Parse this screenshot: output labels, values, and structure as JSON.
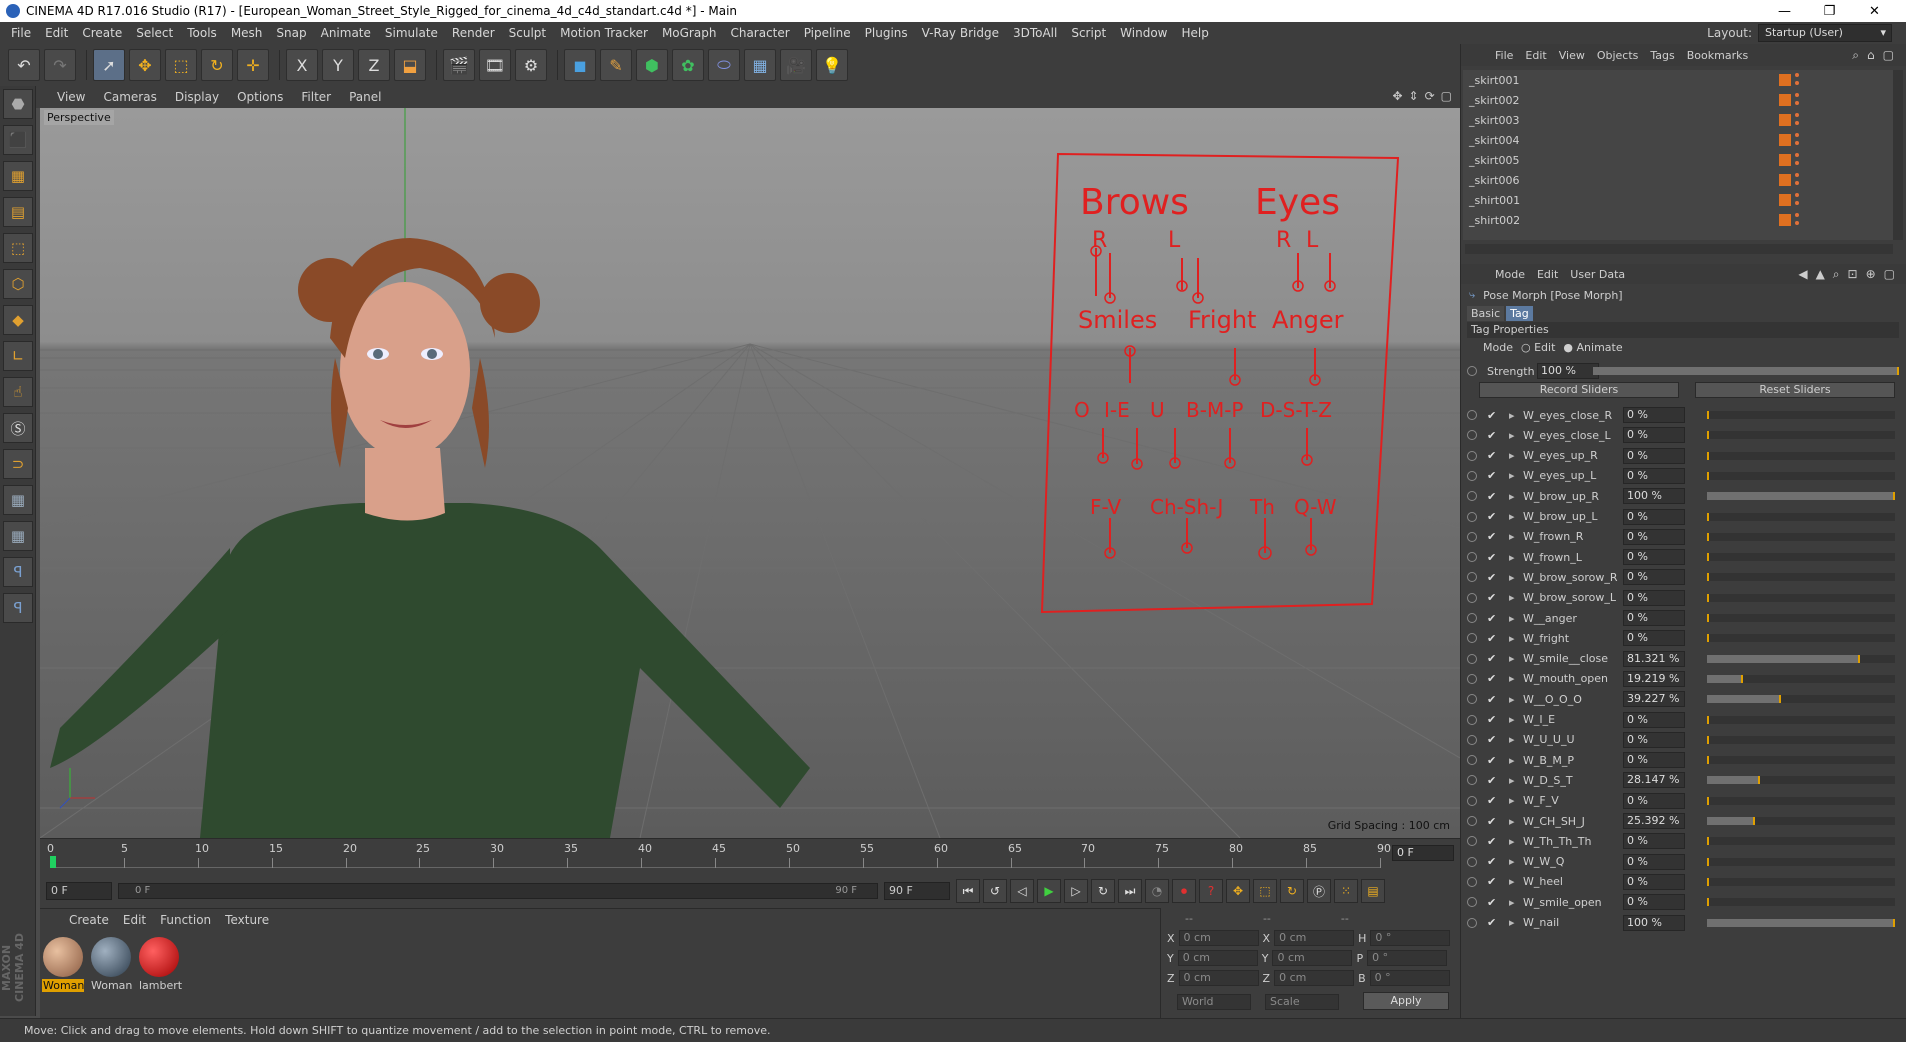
{
  "title_bar": {
    "text": "CINEMA 4D R17.016 Studio (R17) - [European_Woman_Street_Style_Rigged_for_cinema_4d_c4d_standart.c4d *] - Main",
    "minimize": "—",
    "restore": "❐",
    "close": "✕"
  },
  "menu": [
    "File",
    "Edit",
    "Create",
    "Select",
    "Tools",
    "Mesh",
    "Snap",
    "Animate",
    "Simulate",
    "Render",
    "Sculpt",
    "Motion Tracker",
    "MoGraph",
    "Character",
    "Pipeline",
    "Plugins",
    "V-Ray Bridge",
    "3DToAll",
    "Script",
    "Window",
    "Help"
  ],
  "layout": {
    "label": "Layout:",
    "value": "Startup (User)"
  },
  "toolbar_icons": [
    "undo-icon",
    "redo-icon",
    "select-icon",
    "move-icon",
    "scale-icon",
    "rotate-icon",
    "multi-transform-icon",
    "x-axis-icon",
    "y-axis-icon",
    "z-axis-icon",
    "world-coord-icon",
    "render-view-icon",
    "render-picture-viewer-icon",
    "edit-render-settings-icon",
    "cube-icon",
    "pen-icon",
    "subdivision-icon",
    "array-icon",
    "deformer-icon",
    "floor-icon",
    "camera-icon",
    "light-icon"
  ],
  "toolbar_glyphs": {
    "xaxis": "X",
    "yaxis": "Y",
    "zaxis": "Z"
  },
  "viewport_menu": [
    "View",
    "Cameras",
    "Display",
    "Options",
    "Filter",
    "Panel"
  ],
  "viewport": {
    "title": "Perspective",
    "grid_spacing": "Grid Spacing : 100 cm"
  },
  "face_rig": {
    "brows": "Brows",
    "eyes": "Eyes",
    "r": "R",
    "l": "L",
    "smiles": "Smiles",
    "fright": "Fright",
    "anger": "Anger",
    "o": "O",
    "ie": "I-E",
    "u": "U",
    "bmp": "B-M-P",
    "dstz": "D-S-T-Z",
    "fv": "F-V",
    "chshj": "Ch-Sh-J",
    "th": "Th",
    "qw": "Q-W"
  },
  "timeline": {
    "ticks": [
      "0",
      "5",
      "10",
      "15",
      "20",
      "25",
      "30",
      "35",
      "40",
      "45",
      "50",
      "55",
      "60",
      "65",
      "70",
      "75",
      "80",
      "85",
      "90"
    ],
    "current": "0 F"
  },
  "transport": {
    "start": "0 F",
    "slider_start": "0 F",
    "slider_end": "90 F",
    "end": "90 F"
  },
  "material_menu": [
    "Create",
    "Edit",
    "Function",
    "Texture"
  ],
  "materials": [
    {
      "name": "Woman",
      "color": "#b07a55"
    },
    {
      "name": "Woman",
      "color": "#4a5a6a"
    },
    {
      "name": "lambert",
      "color": "#d01515"
    }
  ],
  "coords": {
    "header": [
      "--",
      "--",
      "--"
    ],
    "rows": [
      {
        "a": "X",
        "av": "0 cm",
        "b": "X",
        "bv": "0 cm",
        "c": "H",
        "cv": "0 °"
      },
      {
        "a": "Y",
        "av": "0 cm",
        "b": "Y",
        "bv": "0 cm",
        "c": "P",
        "cv": "0 °"
      },
      {
        "a": "Z",
        "av": "0 cm",
        "b": "Z",
        "bv": "0 cm",
        "c": "B",
        "cv": "0 °"
      }
    ],
    "world": "World",
    "scale": "Scale",
    "apply": "Apply"
  },
  "status": "Move: Click and drag to move elements. Hold down SHIFT to quantize movement / add to the selection in point mode, CTRL to remove.",
  "maxon": "MAXON CINEMA 4D",
  "object_menu": [
    "File",
    "Edit",
    "View",
    "Objects",
    "Tags",
    "Bookmarks"
  ],
  "objects": [
    "_skirt001",
    "_skirt002",
    "_skirt003",
    "_skirt004",
    "_skirt005",
    "_skirt006",
    "_shirt001",
    "_shirt002"
  ],
  "attr_menu": [
    "Mode",
    "Edit",
    "User Data"
  ],
  "attr": {
    "object_title": "Pose Morph [Pose Morph]",
    "tabs": [
      "Basic",
      "Tag"
    ],
    "section": "Tag Properties",
    "mode_label": "Mode",
    "mode_edit": "Edit",
    "mode_animate": "Animate",
    "strength_label": "Strength",
    "strength_value": "100 %",
    "strength_fraction": 1.0,
    "record": "Record Sliders",
    "reset": "Reset Sliders"
  },
  "sliders": [
    {
      "name": "W_eyes_close_R",
      "value": "0 %",
      "f": 0
    },
    {
      "name": "W_eyes_close_L",
      "value": "0 %",
      "f": 0
    },
    {
      "name": "W_eyes_up_R",
      "value": "0 %",
      "f": 0
    },
    {
      "name": "W_eyes_up_L",
      "value": "0 %",
      "f": 0
    },
    {
      "name": "W_brow_up_R",
      "value": "100 %",
      "f": 1
    },
    {
      "name": "W_brow_up_L",
      "value": "0 %",
      "f": 0
    },
    {
      "name": "W_frown_R",
      "value": "0 %",
      "f": 0
    },
    {
      "name": "W_frown_L",
      "value": "0 %",
      "f": 0
    },
    {
      "name": "W_brow_sorow_R",
      "value": "0 %",
      "f": 0
    },
    {
      "name": "W_brow_sorow_L",
      "value": "0 %",
      "f": 0
    },
    {
      "name": "W__anger",
      "value": "0 %",
      "f": 0
    },
    {
      "name": "W_fright",
      "value": "0 %",
      "f": 0
    },
    {
      "name": "W_smile__close",
      "value": "81.321 %",
      "f": 0.81321
    },
    {
      "name": "W_mouth_open",
      "value": "19.219 %",
      "f": 0.19219
    },
    {
      "name": "W__O_O_O",
      "value": "39.227 %",
      "f": 0.39227
    },
    {
      "name": "W_I_E",
      "value": "0 %",
      "f": 0
    },
    {
      "name": "W_U_U_U",
      "value": "0 %",
      "f": 0
    },
    {
      "name": "W_B_M_P",
      "value": "0 %",
      "f": 0
    },
    {
      "name": "W_D_S_T",
      "value": "28.147 %",
      "f": 0.28147
    },
    {
      "name": "W_F_V",
      "value": "0 %",
      "f": 0
    },
    {
      "name": "W_CH_SH_J",
      "value": "25.392 %",
      "f": 0.25392
    },
    {
      "name": "W_Th_Th_Th",
      "value": "0 %",
      "f": 0
    },
    {
      "name": "W_W_Q",
      "value": "0 %",
      "f": 0
    },
    {
      "name": "W_heel",
      "value": "0 %",
      "f": 0
    },
    {
      "name": "W_smile_open",
      "value": "0 %",
      "f": 0
    },
    {
      "name": "W_nail",
      "value": "100 %",
      "f": 1
    }
  ],
  "colors": {
    "accent": "#e0a000",
    "rig": "#e02020",
    "shirt": "#2f4a2f",
    "hair": "#8a4a28",
    "skin": "#d9a08a"
  }
}
